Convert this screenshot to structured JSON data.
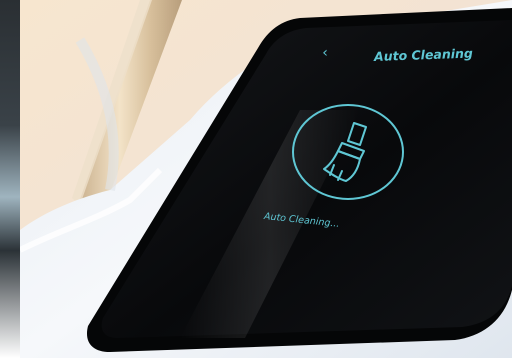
{
  "header": {
    "back_icon": "chevron-left-icon",
    "title": "Auto Cleaning"
  },
  "main": {
    "status_icon": "brush-icon",
    "status_text": "Auto Cleaning..."
  },
  "colors": {
    "accent": "#5fc7d4",
    "screen": "#0b0c0e",
    "device_body": "#eef2f6",
    "background_warm": "#f4e4d0"
  }
}
